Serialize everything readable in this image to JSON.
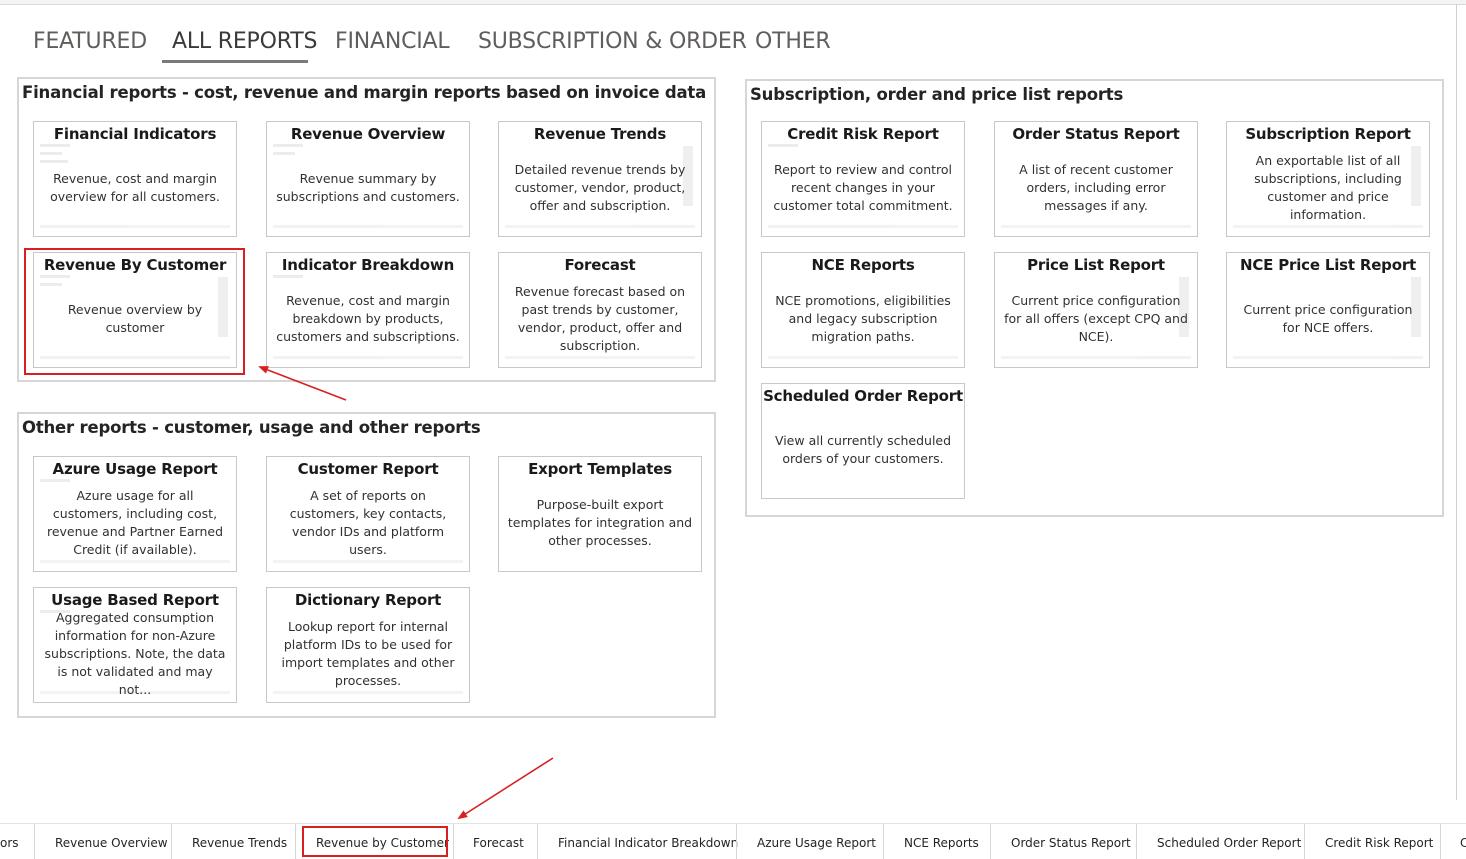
{
  "tabs": [
    {
      "label": "FEATURED",
      "active": false
    },
    {
      "label": "ALL REPORTS",
      "active": true
    },
    {
      "label": "FINANCIAL",
      "active": false
    },
    {
      "label": "SUBSCRIPTION & ORDER",
      "active": false
    },
    {
      "label": "OTHER",
      "active": false
    }
  ],
  "sections": {
    "financial": {
      "title": "Financial reports - cost, revenue and margin reports based on invoice data",
      "cards": [
        {
          "title": "Financial Indicators",
          "desc": "Revenue, cost and margin overview for all customers."
        },
        {
          "title": "Revenue Overview",
          "desc": "Revenue summary by subscriptions and customers."
        },
        {
          "title": "Revenue Trends",
          "desc": "Detailed revenue trends by customer, vendor, product, offer and subscription."
        },
        {
          "title": "Revenue By Customer",
          "desc": "Revenue overview by customer"
        },
        {
          "title": "Indicator Breakdown",
          "desc": "Revenue, cost and margin breakdown by products, customers and subscriptions."
        },
        {
          "title": "Forecast",
          "desc": "Revenue forecast based on past trends by customer, vendor, product, offer and subscription."
        }
      ]
    },
    "other": {
      "title": "Other reports - customer, usage and other reports",
      "cards": [
        {
          "title": "Azure Usage Report",
          "desc": "Azure usage for all customers, including cost, revenue and Partner Earned Credit (if available)."
        },
        {
          "title": "Customer Report",
          "desc": "A set of reports on customers, key contacts, vendor IDs and platform users."
        },
        {
          "title": "Export Templates",
          "desc": "Purpose-built export templates for integration and other processes."
        },
        {
          "title": "Usage Based Report",
          "desc": "Aggregated consumption information for non-Azure subscriptions. Note, the data is not validated and may not..."
        },
        {
          "title": "Dictionary Report",
          "desc": "Lookup report for internal platform IDs to be used for import templates and other processes."
        }
      ]
    },
    "subscription": {
      "title": "Subscription, order and price list reports",
      "cards": [
        {
          "title": "Credit Risk Report",
          "desc": "Report to review and control recent changes in your customer total commitment."
        },
        {
          "title": "Order Status Report",
          "desc": "A list of recent customer orders, including error messages if any."
        },
        {
          "title": "Subscription Report",
          "desc": "An exportable list of all subscriptions, including customer and price information."
        },
        {
          "title": "NCE Reports",
          "desc": "NCE promotions, eligibilities and legacy subscription migration paths."
        },
        {
          "title": "Price List Report",
          "desc": "Current price configuration for all offers (except CPQ and NCE)."
        },
        {
          "title": "NCE Price List Report",
          "desc": "Current price configuration for NCE offers."
        },
        {
          "title": "Scheduled Order Report",
          "desc": "View all currently scheduled orders of your customers."
        }
      ]
    }
  },
  "bottom_tabs": [
    "ors",
    "Revenue Overview",
    "Revenue Trends",
    "Revenue by Customer",
    "Forecast",
    "Financial Indicator Breakdown",
    "Azure Usage Report",
    "NCE Reports",
    "Order Status Report",
    "Scheduled Order Report",
    "Credit Risk Report",
    "C"
  ],
  "colors": {
    "highlight": "#d92020",
    "active_tab_underline": "#7a7a7a"
  }
}
